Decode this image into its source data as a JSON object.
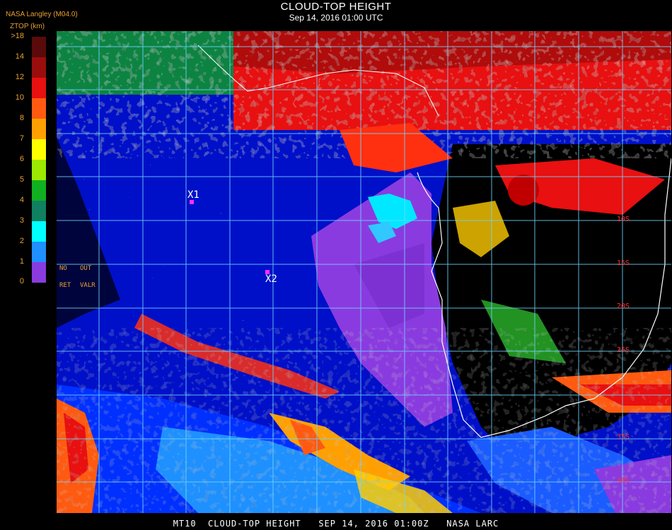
{
  "header": {
    "title": "CLOUD-TOP HEIGHT",
    "datetime": "Sep 14, 2016 01:00 UTC",
    "brand": "NASA Langley (M04.0)",
    "unit": "ZTOP (km)"
  },
  "legend": {
    "entries": [
      {
        "label": ">18",
        "color": "#5a0a0a"
      },
      {
        "label": "14",
        "color": "#9a0d0d"
      },
      {
        "label": "12",
        "color": "#e81010"
      },
      {
        "label": "10",
        "color": "#ff5a10"
      },
      {
        "label": "8",
        "color": "#ffa000"
      },
      {
        "label": "7",
        "color": "#ffff00"
      },
      {
        "label": "6",
        "color": "#9ce800"
      },
      {
        "label": "5",
        "color": "#10b020"
      },
      {
        "label": "4",
        "color": "#108060"
      },
      {
        "label": "3",
        "color": "#00ffff"
      },
      {
        "label": "2",
        "color": "#1e90ff"
      },
      {
        "label": "1",
        "color": "#0020ff"
      },
      {
        "label": "0",
        "color": "#8a3be0"
      }
    ],
    "notes": [
      "NO",
      "OUT",
      "RET",
      "VALR"
    ]
  },
  "map": {
    "lat_labels": [
      "10S",
      "15S",
      "20S",
      "25S",
      "35S",
      "40S"
    ],
    "markers": [
      "X1",
      "X2"
    ]
  },
  "footer": "MT10  CLOUD-TOP HEIGHT   SEP 14, 2016 01:00Z   NASA LARC"
}
